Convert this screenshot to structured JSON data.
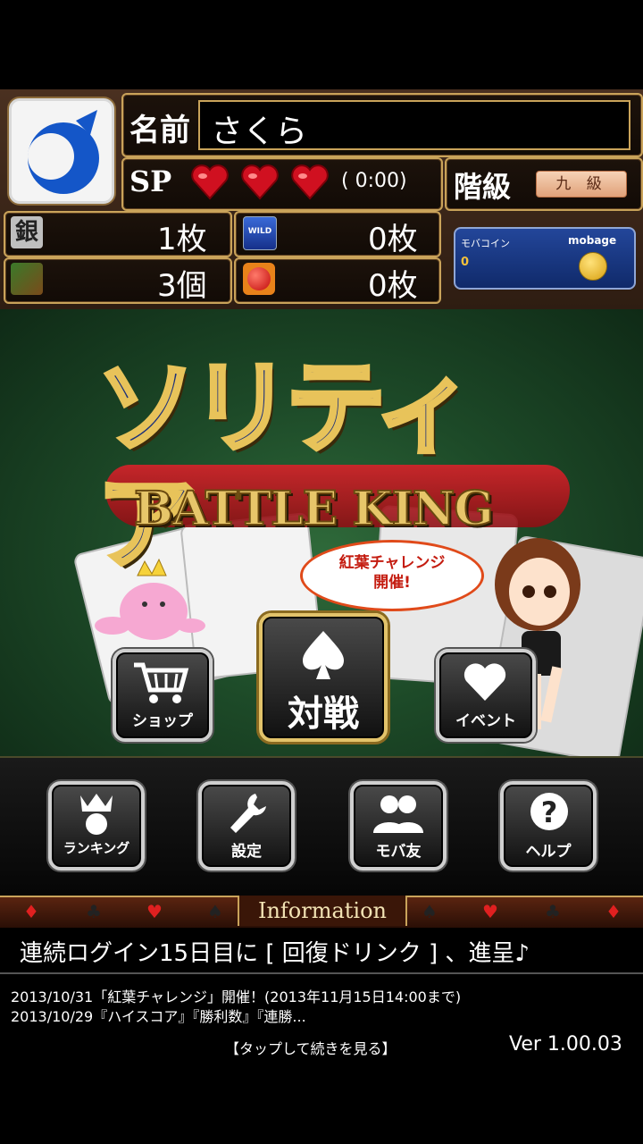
{
  "profile": {
    "name_label": "名前",
    "name_value": "さくら",
    "sp_label": "SP",
    "sp_hearts": 3,
    "sp_timer": "( 0:00)",
    "rank_label": "階級",
    "rank_value": "九 級"
  },
  "resources": {
    "silver_icon": "銀",
    "silver": "1枚",
    "wild": "0枚",
    "wild_icon_text": "WILD",
    "drink": "3個",
    "ball": "0枚"
  },
  "mobage": {
    "label": "モバコイン",
    "brand": "mobage",
    "coins": "0"
  },
  "logo": {
    "jp": "ソリティア",
    "en": "BATTLE KING",
    "event_bubble_line1": "紅葉チャレンジ",
    "event_bubble_line2": "開催!"
  },
  "buttons": {
    "shop": "ショップ",
    "battle": "対戦",
    "event": "イベント",
    "ranking": "ランキング",
    "settings": "設定",
    "friends": "モバ友",
    "help": "ヘルプ"
  },
  "info": {
    "title": "Information",
    "headline": "連続ログイン15日目に [ 回復ドリンク ] 、進呈♪",
    "news": [
      "2013/10/31「紅葉チャレンジ」開催！(2013年11月15日14:00まで)",
      "2013/10/29『ハイスコア』『勝利数』『連勝..."
    ],
    "more": "【タップして続きを見る】",
    "version": "Ver 1.00.03"
  },
  "colors": {
    "gold": "#c9a35a",
    "heart": "#d01020",
    "felt": "#1d4a28"
  }
}
